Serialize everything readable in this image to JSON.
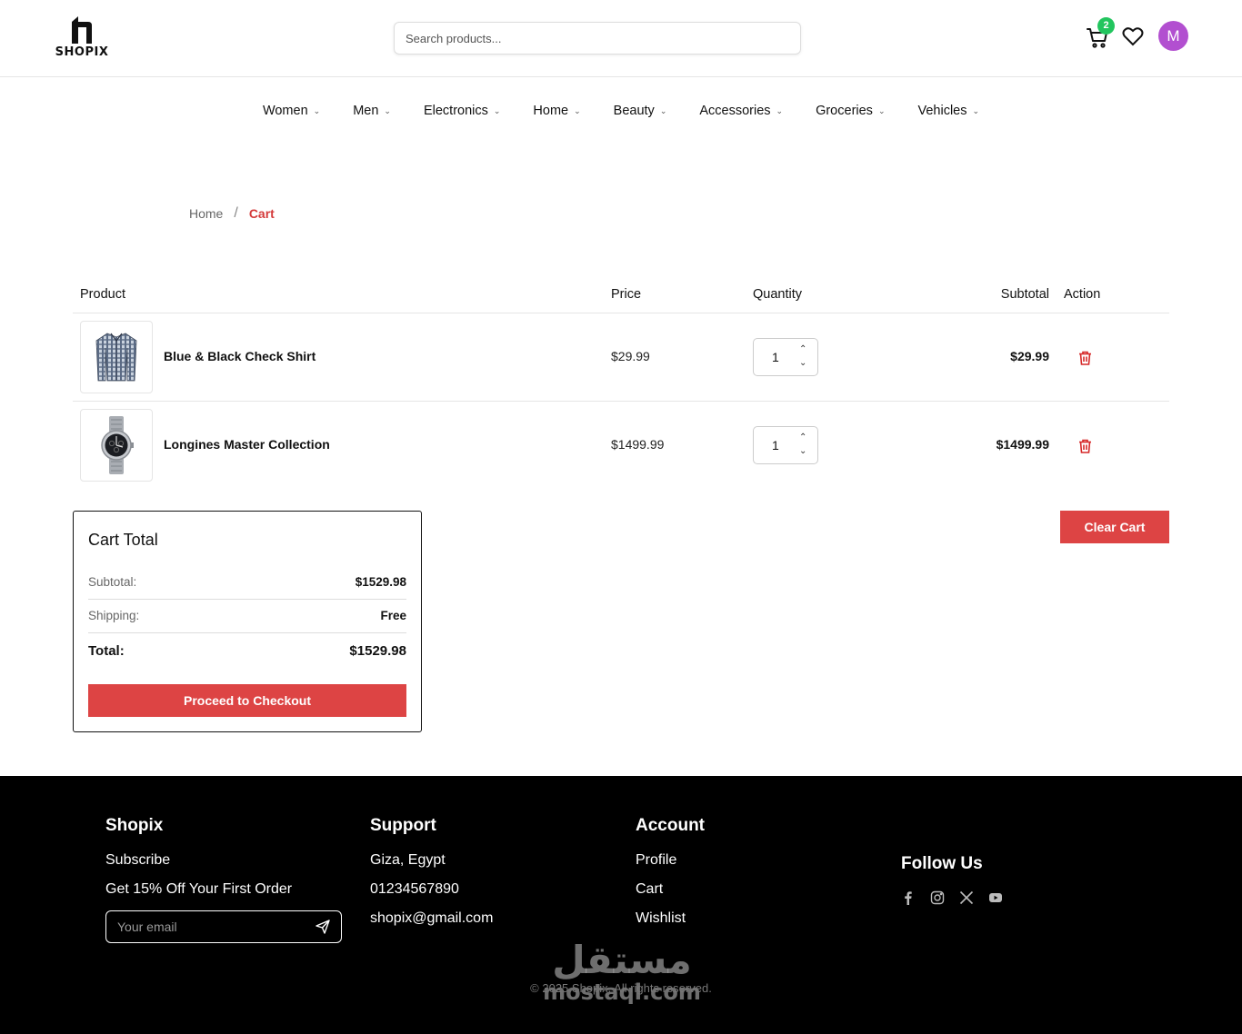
{
  "header": {
    "logo_text": "SHOPIX",
    "search_placeholder": "Search products...",
    "cart_count": "2",
    "avatar_initial": "M"
  },
  "nav": {
    "items": [
      "Women",
      "Men",
      "Electronics",
      "Home",
      "Beauty",
      "Accessories",
      "Groceries",
      "Vehicles"
    ]
  },
  "breadcrumb": {
    "home": "Home",
    "separator": "/",
    "current": "Cart"
  },
  "table": {
    "headers": {
      "product": "Product",
      "price": "Price",
      "quantity": "Quantity",
      "subtotal": "Subtotal",
      "action": "Action"
    },
    "rows": [
      {
        "name": "Blue & Black Check Shirt",
        "price": "$29.99",
        "quantity": "1",
        "subtotal": "$29.99",
        "image_icon": "shirt-image"
      },
      {
        "name": "Longines Master Collection",
        "price": "$1499.99",
        "quantity": "1",
        "subtotal": "$1499.99",
        "image_icon": "watch-image"
      }
    ]
  },
  "cart_total": {
    "title": "Cart Total",
    "subtotal_label": "Subtotal:",
    "subtotal_value": "$1529.98",
    "shipping_label": "Shipping:",
    "shipping_value": "Free",
    "total_label": "Total:",
    "total_value": "$1529.98",
    "checkout_label": "Proceed to Checkout"
  },
  "clear_cart_label": "Clear Cart",
  "footer": {
    "brand": {
      "title": "Shopix",
      "subscribe": "Subscribe",
      "offer": "Get 15% Off Your First Order",
      "email_placeholder": "Your email"
    },
    "support": {
      "title": "Support",
      "address": "Giza, Egypt",
      "phone": "01234567890",
      "email": "shopix@gmail.com"
    },
    "account": {
      "title": "Account",
      "links": [
        "Profile",
        "Cart",
        "Wishlist"
      ]
    },
    "follow": {
      "title": "Follow Us",
      "icons": [
        "facebook-icon",
        "instagram-icon",
        "x-icon",
        "youtube-icon"
      ]
    },
    "copyright": "© 2025 Shopix. All rights reserved.",
    "watermark_ar": "مستقل",
    "watermark_en": "mostaql.com"
  },
  "colors": {
    "accent": "#dd4444",
    "badge": "#22c55e",
    "avatar": "#b24fd0",
    "footer_bg": "#000000"
  }
}
